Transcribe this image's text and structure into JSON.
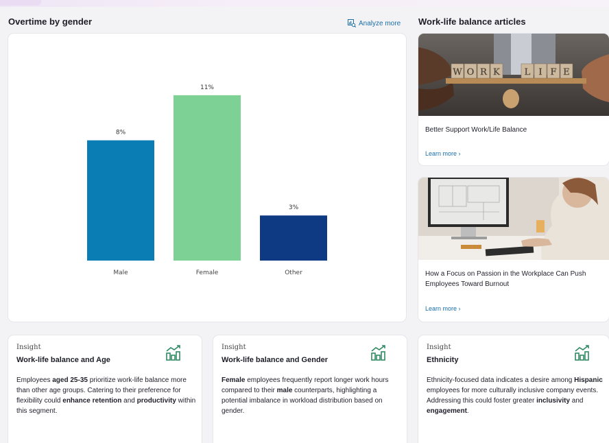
{
  "chart_section": {
    "title": "Overtime by gender",
    "analyze_label": "Analyze more"
  },
  "chart_data": {
    "type": "bar",
    "categories": [
      "Male",
      "Female",
      "Other"
    ],
    "values": [
      8,
      11,
      3
    ],
    "value_labels": [
      "8%",
      "11%",
      "3%"
    ],
    "colors": [
      "#0b7db5",
      "#7dd195",
      "#0e3a84"
    ],
    "title": "",
    "xlabel": "",
    "ylabel": "",
    "ylim": [
      0,
      13
    ],
    "grid": false
  },
  "articles": {
    "title": "Work-life balance  articles",
    "items": [
      {
        "title": "Better Support Work/Life Balance",
        "link": "Learn more"
      },
      {
        "title": "How a Focus on Passion in the Workplace Can Push Employees Toward Burnout",
        "link": "Learn more"
      }
    ],
    "image_letters": [
      "W",
      "O",
      "R",
      "K",
      "L",
      "I",
      "F",
      "E"
    ]
  },
  "insights": [
    {
      "label": "Insight",
      "title": "Work-life balance and Age",
      "body": [
        {
          "t": "Employees "
        },
        {
          "t": "aged 25-35",
          "b": true
        },
        {
          "t": " prioritize work-life balance more than other age groups. Catering to their preference for flexibility could "
        },
        {
          "t": "enhance retention",
          "b": true
        },
        {
          "t": " and "
        },
        {
          "t": "productivity",
          "b": true
        },
        {
          "t": " within this segment."
        }
      ]
    },
    {
      "label": "Insight",
      "title": "Work-life balance and Gender",
      "body": [
        {
          "t": "Female",
          "b": true
        },
        {
          "t": " employees frequently report longer work hours compared to their "
        },
        {
          "t": "male",
          "b": true
        },
        {
          "t": " counterparts, highlighting a potential imbalance in workload distribution based on gender."
        }
      ]
    },
    {
      "label": "Insight",
      "title": "Ethnicity",
      "body": [
        {
          "t": "Ethnicity-focused data indicates a desire among "
        },
        {
          "t": "Hispanic",
          "b": true
        },
        {
          "t": " employees for more culturally inclusive company events. Addressing this could foster greater "
        },
        {
          "t": "inclusivity",
          "b": true
        },
        {
          "t": " and "
        },
        {
          "t": "engagement",
          "b": true
        },
        {
          "t": "."
        }
      ]
    }
  ],
  "icons": {
    "analyze": "magnify-chart-icon",
    "insight": "trend-bar-chart-icon",
    "chevron": "chevron-right-icon"
  },
  "colors": {
    "accent_link": "#1a6ea8",
    "icon_green": "#2f8a63"
  }
}
